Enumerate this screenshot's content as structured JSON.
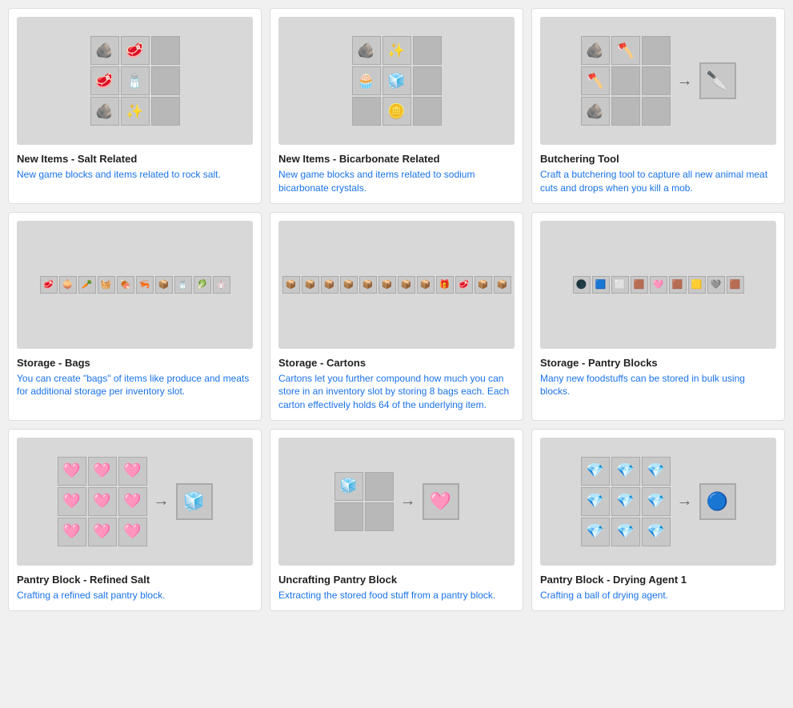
{
  "cards": [
    {
      "id": "new-items-salt",
      "title": "New Items - Salt Related",
      "desc_black": "",
      "desc_blue": "New game blocks and items related to rock salt.",
      "image_type": "3x3_craft_no_arrow",
      "cells": [
        "🪨",
        "🥩",
        "",
        "🥩",
        "🧂",
        "",
        "🪨",
        "✨",
        ""
      ]
    },
    {
      "id": "new-items-bicarb",
      "title": "New Items - Bicarbonate Related",
      "desc_black": "",
      "desc_blue": "New game blocks and items related to sodium bicarbonate crystals.",
      "image_type": "3x3_craft_no_arrow",
      "cells": [
        "🪨",
        "✨",
        "",
        "🧁",
        "🧊",
        "",
        "",
        "🪙",
        ""
      ]
    },
    {
      "id": "butchering-tool",
      "title": "Butchering Tool",
      "desc_black": "",
      "desc_blue": "Craft a butchering tool to capture all new animal meat cuts and drops when you kill a mob.",
      "image_type": "3x3_craft_arrow",
      "cells": [
        "🪨",
        "🪓",
        "",
        "🪓",
        "",
        "",
        "🪨",
        "",
        ""
      ],
      "result": "🔪"
    },
    {
      "id": "storage-bags",
      "title": "Storage - Bags",
      "desc_black": "",
      "desc_blue": "You can create \"bags\" of items like produce and meats for additional storage per inventory slot.",
      "image_type": "wide_row",
      "items": [
        "🥩",
        "🧅",
        "🥕",
        "🧺",
        "🍖",
        "🦐",
        "📦",
        "🧂",
        "🥬",
        "🧄"
      ]
    },
    {
      "id": "storage-cartons",
      "title": "Storage - Cartons",
      "desc_black": "",
      "desc_blue": "Cartons let you further compound how much you can store in an inventory slot by storing 8 bags each. Each carton effectively holds 64 of the underlying item.",
      "image_type": "wide_row",
      "items": [
        "📦",
        "📦",
        "📦",
        "📦",
        "📦",
        "📦",
        "📦",
        "📦",
        "🎁",
        "🥩",
        "📦",
        "📦"
      ]
    },
    {
      "id": "storage-pantry-blocks",
      "title": "Storage - Pantry Blocks",
      "desc_black": "",
      "desc_blue": "Many new foodstuffs can be stored in bulk using blocks.",
      "image_type": "wide_row",
      "items": [
        "🌑",
        "🟦",
        "⬜",
        "🟫",
        "🩷",
        "🟫",
        "🟨",
        "🩶",
        "🟫"
      ]
    },
    {
      "id": "pantry-block-refined-salt",
      "title": "Pantry Block - Refined Salt",
      "desc_black": "",
      "desc_blue": "Crafting a refined salt pantry block.",
      "image_type": "3x3_craft_arrow",
      "cells": [
        "🩷",
        "🩷",
        "🩷",
        "🩷",
        "🩷",
        "🩷",
        "🩷",
        "🩷",
        "🩷"
      ],
      "result": "🧊"
    },
    {
      "id": "uncrafting-pantry-block",
      "title": "Uncrafting Pantry Block",
      "desc_black": "",
      "desc_blue": "Extracting the stored food stuff from a pantry block.",
      "image_type": "2x2_craft_arrow",
      "cells": [
        "🧊",
        "",
        "",
        ""
      ],
      "result": "🩷"
    },
    {
      "id": "pantry-block-drying-agent",
      "title": "Pantry Block - Drying Agent 1",
      "desc_black": "",
      "desc_blue": "Crafting a ball of drying agent.",
      "image_type": "3x3_craft_arrow",
      "cells": [
        "💎",
        "💎",
        "💎",
        "💎",
        "💎",
        "💎",
        "💎",
        "💎",
        "💎"
      ],
      "result": "🔵"
    }
  ],
  "colors": {
    "bg": "#f0f0f0",
    "card_bg": "#ffffff",
    "image_bg": "#d8d8d8",
    "title_color": "#222222",
    "desc_color": "#1a73e8",
    "arrow_color": "#666666"
  }
}
